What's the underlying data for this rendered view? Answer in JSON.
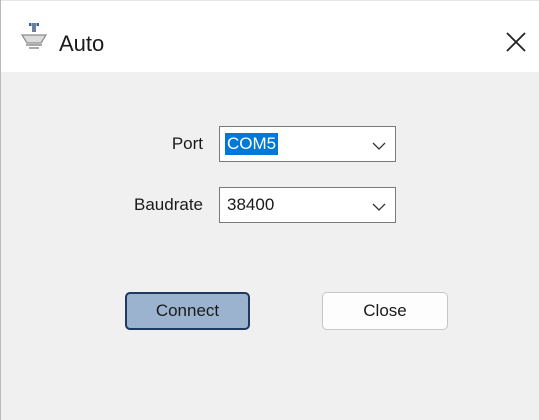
{
  "window": {
    "title": "Auto",
    "app_icon": "device-icon",
    "close_icon": "close-icon"
  },
  "form": {
    "port": {
      "label": "Port",
      "value": "COM5"
    },
    "baudrate": {
      "label": "Baudrate",
      "value": "38400"
    }
  },
  "buttons": {
    "connect_label": "Connect",
    "close_label": "Close"
  },
  "colors": {
    "selection": "#0078d7",
    "connect_button_fill": "#9bb3cf",
    "connect_button_border": "#1e3a5f"
  }
}
